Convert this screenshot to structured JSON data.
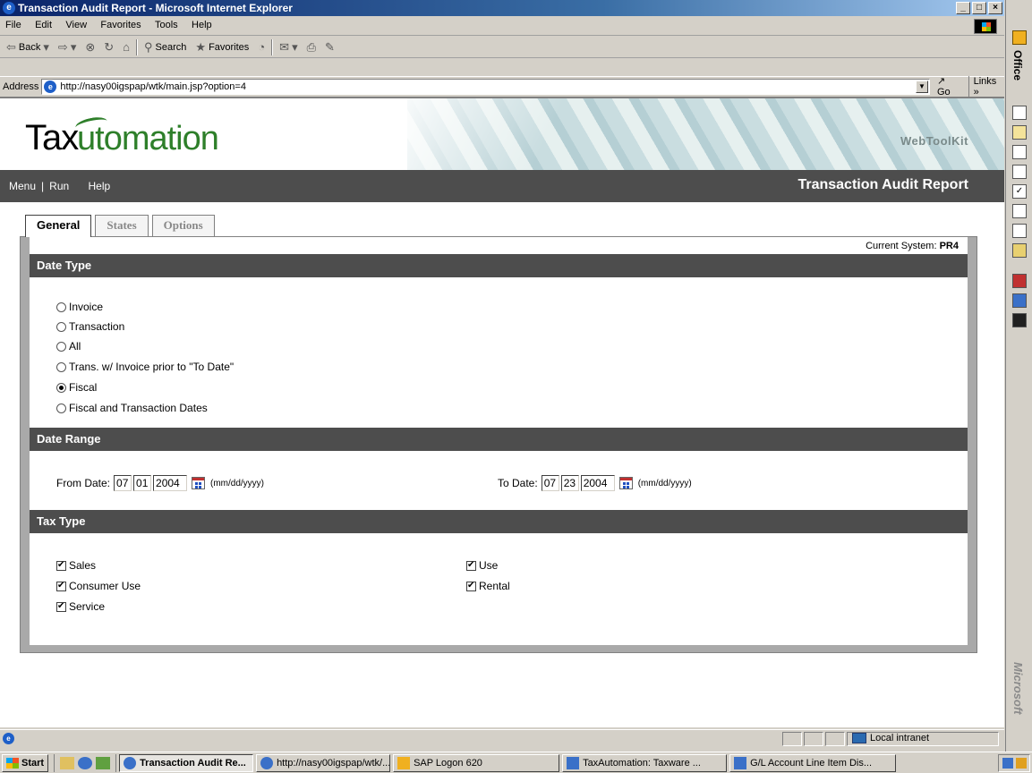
{
  "window": {
    "title": "Transaction Audit Report - Microsoft Internet Explorer"
  },
  "menu": [
    "File",
    "Edit",
    "View",
    "Favorites",
    "Tools",
    "Help"
  ],
  "toolbar": {
    "back": "Back",
    "search": "Search",
    "favorites": "Favorites"
  },
  "address": {
    "label": "Address",
    "url": "http://nasy00igspap/wtk/main.jsp?option=4",
    "go": "Go",
    "links": "Links »"
  },
  "banner": {
    "brand_tax": "Tax",
    "brand_auto": "utomation",
    "product": "WebToolKit"
  },
  "nav": {
    "menu": "Menu",
    "run": "Run",
    "help": "Help",
    "title": "Transaction Audit Report"
  },
  "tabs": [
    "General",
    "States",
    "Options"
  ],
  "current_system": {
    "label": "Current System:",
    "value": "PR4"
  },
  "date_type": {
    "heading": "Date Type",
    "options": [
      "Invoice",
      "Transaction",
      "All",
      "Trans. w/ Invoice prior to \"To Date\"",
      "Fiscal",
      "Fiscal and Transaction Dates"
    ],
    "selected": "Fiscal"
  },
  "date_range": {
    "heading": "Date Range",
    "from_label": "From Date:",
    "from_mm": "07",
    "from_dd": "01",
    "from_yyyy": "2004",
    "to_label": "To Date:",
    "to_mm": "07",
    "to_dd": "23",
    "to_yyyy": "2004",
    "format": "(mm/dd/yyyy)"
  },
  "tax_type": {
    "heading": "Tax Type",
    "sales": "Sales",
    "consumer_use": "Consumer Use",
    "service": "Service",
    "use": "Use",
    "rental": "Rental"
  },
  "status": {
    "zone": "Local intranet"
  },
  "taskbar": {
    "start": "Start",
    "tasks": [
      "Transaction Audit Re...",
      "http://nasy00igspap/wtk/...",
      "SAP Logon 620",
      "TaxAutomation: Taxware ...",
      "G/L Account Line Item Dis..."
    ]
  },
  "office_bar": {
    "title": "Office",
    "brand": "Microsoft"
  }
}
